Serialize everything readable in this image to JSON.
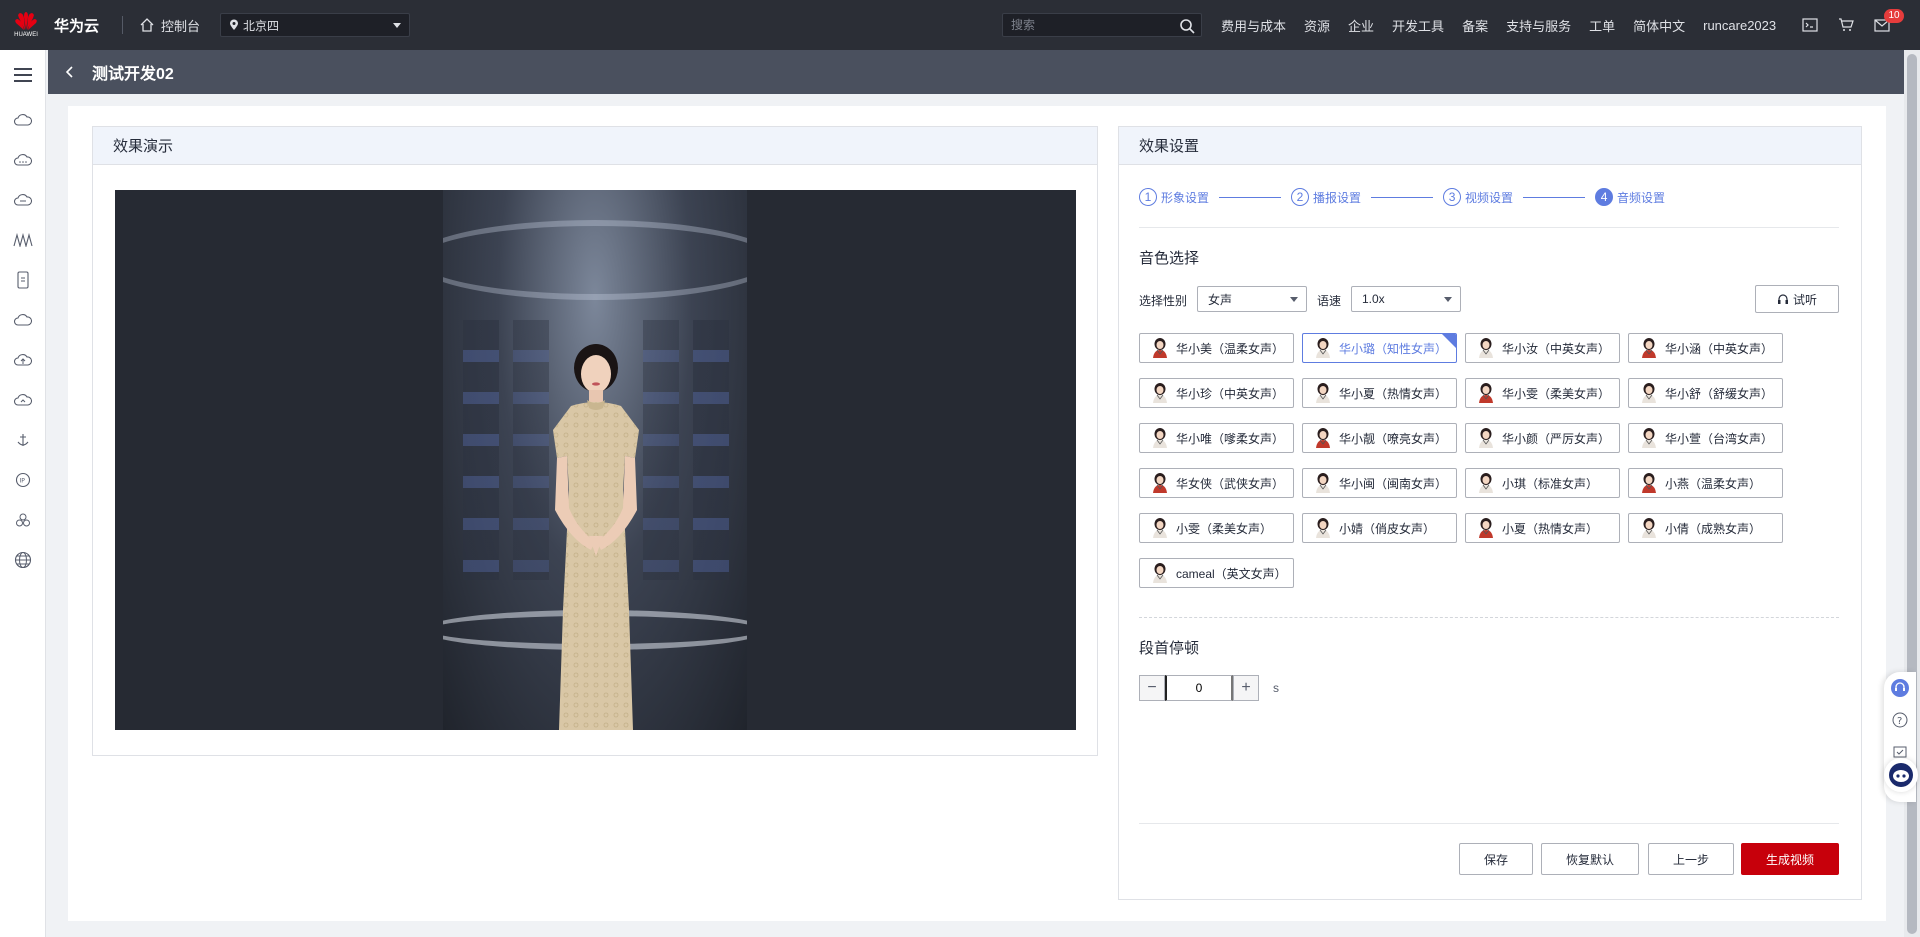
{
  "topbar": {
    "brand": "华为云",
    "brand_sub": "HUAWEI",
    "console": "控制台",
    "region": "北京四",
    "search_placeholder": "搜索",
    "nav": [
      "费用与成本",
      "资源",
      "企业",
      "开发工具",
      "备案",
      "支持与服务",
      "工单",
      "简体中文",
      "runcare2023"
    ],
    "mail_badge": "10"
  },
  "page": {
    "title": "测试开发02"
  },
  "preview": {
    "title": "效果演示"
  },
  "settings": {
    "title": "效果设置",
    "steps": [
      {
        "num": "1",
        "label": "形象设置"
      },
      {
        "num": "2",
        "label": "播报设置"
      },
      {
        "num": "3",
        "label": "视频设置"
      },
      {
        "num": "4",
        "label": "音频设置"
      }
    ],
    "voice_section": "音色选择",
    "gender_label": "选择性别",
    "gender_value": "女声",
    "speed_label": "语速",
    "speed_value": "1.0x",
    "audition_label": "试听",
    "voices": [
      "华小美（温柔女声）",
      "华小璐（知性女声）",
      "华小汝（中英女声）",
      "华小涵（中英女声）",
      "华小珍（中英女声）",
      "华小夏（热情女声）",
      "华小雯（柔美女声）",
      "华小舒（舒缓女声）",
      "华小唯（嗲柔女声）",
      "华小靓（嘹亮女声）",
      "华小颜（严厉女声）",
      "华小萱（台湾女声）",
      "华女侠（武侠女声）",
      "华小闽（闽南女声）",
      "小琪（标准女声）",
      "小燕（温柔女声）",
      "小雯（柔美女声）",
      "小婧（俏皮女声）",
      "小夏（热情女声）",
      "小倩（成熟女声）",
      "cameal（英文女声）"
    ],
    "selected_voice": "华小璐（知性女声）",
    "pause_section": "段首停顿",
    "pause_value": "0",
    "pause_unit": "s",
    "buttons": {
      "save": "保存",
      "reset": "恢复默认",
      "prev": "上一步",
      "generate": "生成视频"
    }
  },
  "colors": {
    "accent": "#5e7ce0",
    "primary": "#c7000b",
    "topbar": "#2b2e36"
  }
}
